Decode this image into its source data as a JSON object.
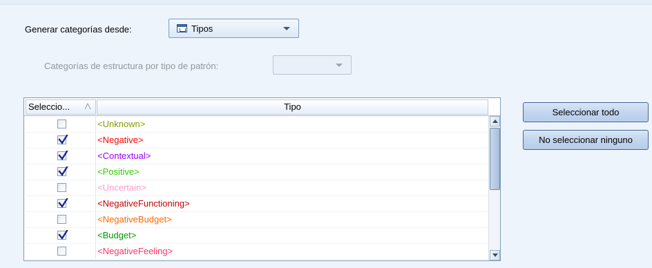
{
  "generar": {
    "label": "Generar categorías desde:",
    "value": "Tipos",
    "icon": "tipos-icon"
  },
  "estructura": {
    "label": "Categorías de estructura por tipo de patrón:",
    "value": ""
  },
  "table": {
    "col_select": "Seleccio...",
    "col_tipo": "Tipo",
    "rows": [
      {
        "checked": false,
        "label": "<Unknown>",
        "color": "#8a9a00"
      },
      {
        "checked": true,
        "label": "<Negative>",
        "color": "#ff0000"
      },
      {
        "checked": true,
        "label": "<Contextual>",
        "color": "#9900ff"
      },
      {
        "checked": true,
        "label": "<Positive>",
        "color": "#33cc00"
      },
      {
        "checked": false,
        "label": "<Uncertain>",
        "color": "#ff99cc"
      },
      {
        "checked": true,
        "label": "<NegativeFunctioning>",
        "color": "#cc0000"
      },
      {
        "checked": false,
        "label": "<NegativeBudget>",
        "color": "#ff6600"
      },
      {
        "checked": true,
        "label": "<Budget>",
        "color": "#009900"
      },
      {
        "checked": false,
        "label": "<NegativeFeeling>",
        "color": "#ff3366"
      }
    ]
  },
  "buttons": {
    "select_all": "Seleccionar todo",
    "select_none": "No seleccionar ninguno"
  },
  "colors": {
    "background": "#eef4fb",
    "button_border": "#3f6699",
    "check": "#1a2a8c"
  }
}
